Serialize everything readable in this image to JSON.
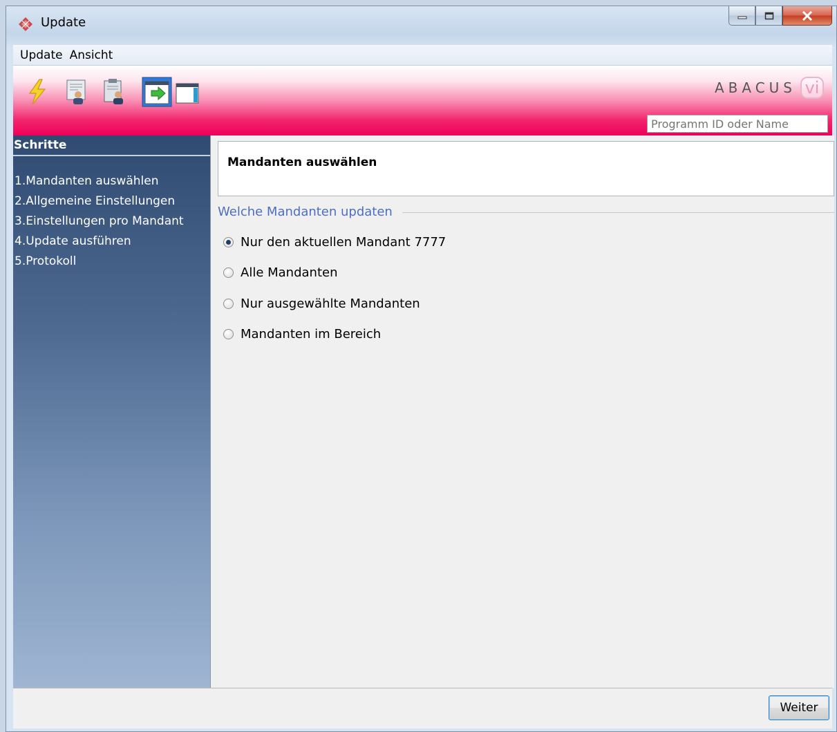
{
  "window": {
    "title": "Update"
  },
  "menu": {
    "items": [
      "Update",
      "Ansicht"
    ]
  },
  "toolbar": {
    "icons": [
      "lightning-icon",
      "document-person-icon",
      "clipboard-person-icon",
      "window-arrow-icon",
      "window-icon"
    ],
    "brand": "ABACUS",
    "brand_badge": "vi",
    "search_placeholder": "Programm ID oder Name"
  },
  "sidebar": {
    "title": "Schritte",
    "steps": [
      "1.Mandanten auswählen",
      "2.Allgemeine Einstellungen",
      "3.Einstellungen pro Mandant",
      "4.Update ausführen",
      "5.Protokoll"
    ]
  },
  "main": {
    "header": "Mandanten auswählen",
    "group_label": "Welche Mandanten updaten",
    "options": [
      {
        "label": "Nur den aktuellen Mandant 7777",
        "selected": true
      },
      {
        "label": "Alle Mandanten",
        "selected": false
      },
      {
        "label": "Nur ausgewählte Mandanten",
        "selected": false
      },
      {
        "label": "Mandanten im Bereich",
        "selected": false
      }
    ]
  },
  "footer": {
    "next_label": "Weiter"
  },
  "colors": {
    "toolbar_accent": "#ed005a",
    "sidebar_dark": "#2f4b72",
    "group_label": "#4d6ebf"
  }
}
